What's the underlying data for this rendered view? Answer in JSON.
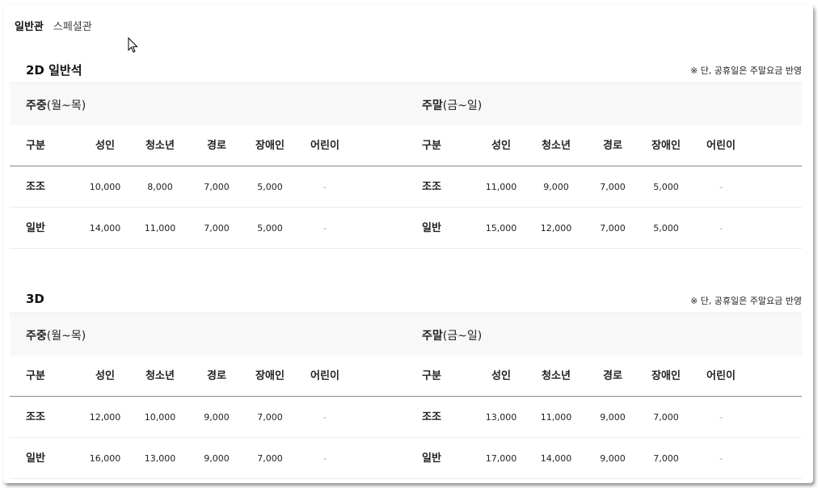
{
  "tabs": [
    "일반관",
    "스페셜관"
  ],
  "note": "※  단, 공휴일은 주말요금 반영",
  "weekday_label_bold": "주중",
  "weekday_label_rest": "(월~목)",
  "weekend_label_bold": "주말",
  "weekend_label_rest": "(금~일)",
  "columns": [
    "구분",
    "성인",
    "청소년",
    "경로",
    "장애인",
    "어린이"
  ],
  "sections": [
    {
      "title": "2D 일반석",
      "weekday": [
        [
          "조조",
          "10,000",
          "8,000",
          "7,000",
          "5,000",
          "-"
        ],
        [
          "일반",
          "14,000",
          "11,000",
          "7,000",
          "5,000",
          "-"
        ]
      ],
      "weekend": [
        [
          "조조",
          "11,000",
          "9,000",
          "7,000",
          "5,000",
          "-"
        ],
        [
          "일반",
          "15,000",
          "12,000",
          "7,000",
          "5,000",
          "-"
        ]
      ]
    },
    {
      "title": "3D",
      "weekday": [
        [
          "조조",
          "12,000",
          "10,000",
          "9,000",
          "7,000",
          "-"
        ],
        [
          "일반",
          "16,000",
          "13,000",
          "9,000",
          "7,000",
          "-"
        ]
      ],
      "weekend": [
        [
          "조조",
          "13,000",
          "11,000",
          "9,000",
          "7,000",
          "-"
        ],
        [
          "일반",
          "17,000",
          "14,000",
          "9,000",
          "7,000",
          "-"
        ]
      ]
    }
  ]
}
